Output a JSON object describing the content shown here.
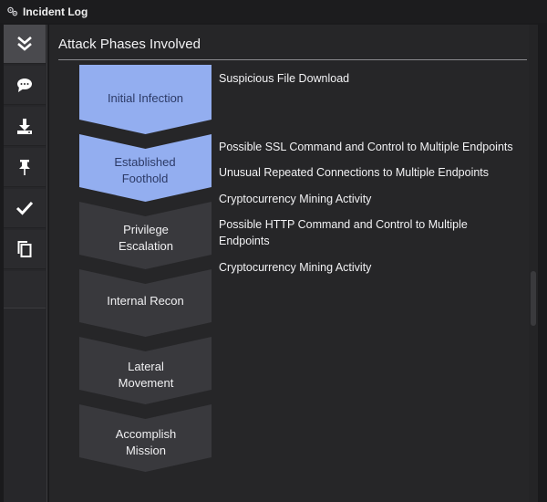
{
  "window": {
    "title": "Incident Log",
    "icon": "gear-cluster-icon"
  },
  "sidebar": {
    "items": [
      {
        "name": "collapse",
        "icon": "double-chevron-down-icon",
        "active": true
      },
      {
        "name": "comments",
        "icon": "speech-bubble-icon",
        "active": false
      },
      {
        "name": "download",
        "icon": "download-icon",
        "active": false
      },
      {
        "name": "pin",
        "icon": "pin-icon",
        "active": false
      },
      {
        "name": "resolve",
        "icon": "checkmark-icon",
        "active": false
      },
      {
        "name": "copy",
        "icon": "copy-icon",
        "active": false
      }
    ]
  },
  "panel": {
    "title": "Attack Phases Involved"
  },
  "colors": {
    "phase_active": "#93aef0",
    "phase_inactive": "#39393d",
    "phase_active_text": "#2c3a66",
    "phase_inactive_text": "#f0f0f2"
  },
  "phases": [
    {
      "label": "Initial Infection",
      "active": true
    },
    {
      "label": "Established Foothold",
      "active": true
    },
    {
      "label": "Privilege Escalation",
      "active": false
    },
    {
      "label": "Internal Recon",
      "active": false
    },
    {
      "label": "Lateral Movement",
      "active": false
    },
    {
      "label": "Accomplish Mission",
      "active": false
    }
  ],
  "events": [
    "Suspicious File Download",
    "Possible SSL Command and Control to Multiple Endpoints",
    "Unusual Repeated Connections to Multiple Endpoints",
    "Cryptocurrency Mining Activity",
    "Possible HTTP Command and Control to Multiple Endpoints",
    "Cryptocurrency Mining Activity"
  ]
}
